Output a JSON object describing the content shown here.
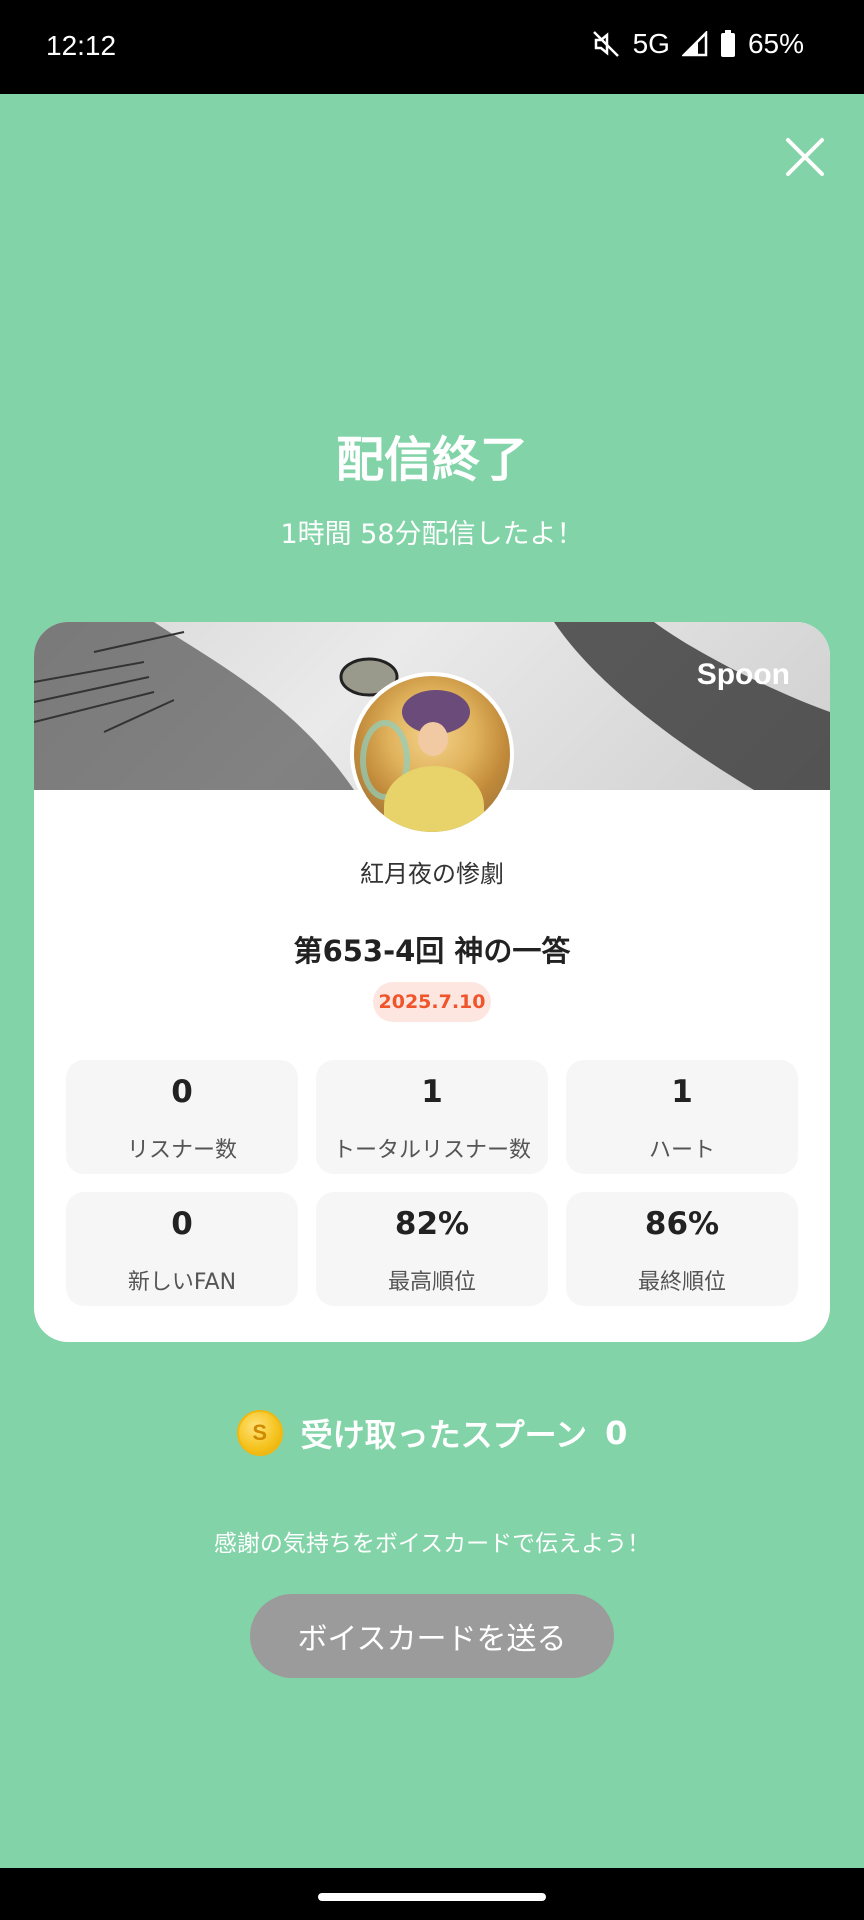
{
  "status_bar": {
    "time": "12:12",
    "network": "5G",
    "battery": "65%"
  },
  "icons": {
    "close": "close-icon",
    "mute": "mute-icon",
    "signal": "signal-icon",
    "battery": "battery-icon",
    "coin": "spoon-coin-icon"
  },
  "header": {
    "title": "配信終了",
    "subtitle": "1時間 58分配信したよ！"
  },
  "card": {
    "brand": "Spoon",
    "user_name": "紅月夜の惨劇",
    "stream_title": "第653-4回 神の一答",
    "date": "2025.7.10",
    "stats": [
      {
        "value": "0",
        "label": "リスナー数"
      },
      {
        "value": "1",
        "label": "トータルリスナー数"
      },
      {
        "value": "1",
        "label": "ハート"
      },
      {
        "value": "0",
        "label": "新しいFAN"
      },
      {
        "value": "82%",
        "label": "最高順位"
      },
      {
        "value": "86%",
        "label": "最終順位"
      }
    ]
  },
  "spoons": {
    "label": "受け取ったスプーン",
    "count": "0",
    "coin_letter": "S"
  },
  "footer": {
    "thanks_text": "感謝の気持ちをボイスカードで伝えよう！",
    "voice_card_button": "ボイスカードを送る"
  },
  "colors": {
    "background": "#82d4a8",
    "date_badge_text": "#f0542a",
    "button": "#9b9b9b"
  }
}
